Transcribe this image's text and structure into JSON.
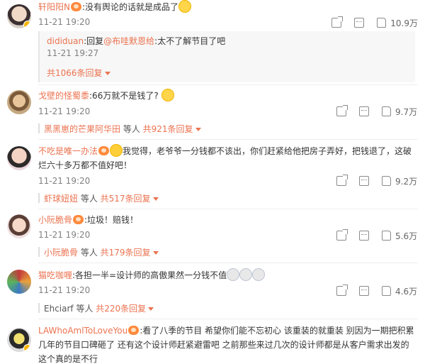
{
  "comments": [
    {
      "user": "轩阳阳N",
      "text": ":没有舆论的话就是成品了",
      "time": "11-21 19:20",
      "likes": "10.9万",
      "reply": {
        "user": "dididuan",
        "prefix": ":回复",
        "mention": "@布哇默恩给",
        "text": ":太不了解节目了吧",
        "time": "11-21 19:27"
      },
      "more": "共1066条回复"
    },
    {
      "user": "戈壁的怪蜀黍",
      "text": ":66万就不是钱了?",
      "time": "11-21 19:20",
      "likes": "9.7万",
      "sub_user": "黑黑崽的芒果阿华田",
      "sub_mid": " 等人 ",
      "more": "共921条回复"
    },
    {
      "user": "不吃是唯一办法",
      "text": "我觉得，老爷爷一分钱都不该出，你们赶紧给他把房子弄好，把钱退了，这破烂六十多万都不值好吧！",
      "time": "11-21 19:20",
      "likes": "9.2万",
      "sub_user": "虾球妞妞",
      "sub_mid": " 等人 ",
      "more": "共517条回复"
    },
    {
      "user": "小阮脆骨",
      "text": ":垃圾！赔钱！",
      "time": "11-21 19:20",
      "likes": "5.6万",
      "sub_user": "小阮脆骨",
      "sub_mid": " 等人 ",
      "more": "共179条回复"
    },
    {
      "user": "猫吃咖喱",
      "text": ":各担一半=设计师的高傲果然一分钱不值",
      "time": "11-21 19:20",
      "likes": "4.6万",
      "sub_user": "Ehciarf",
      "sub_mid": " 等人 ",
      "more": "共220条回复"
    },
    {
      "user": "LAWhoAmlToLoveYou",
      "text": ":看了八季的节目 希望你们能不忘初心 该重装的就重装 别因为一期把积累几年的节目口碑砸了 还有这个设计师赶紧避雷吧 之前那些来过几次的设计师都是从客户需求出发的 这个真的是不行"
    }
  ],
  "icons": {
    "share": "share-icon",
    "comment": "comment-icon",
    "like": "like-icon",
    "medal": "fan-medal-icon",
    "verified": "verified-badge-icon"
  },
  "colors": {
    "username": "#eb7350",
    "time": "#808080",
    "reply_bg": "#f7f7f7"
  }
}
